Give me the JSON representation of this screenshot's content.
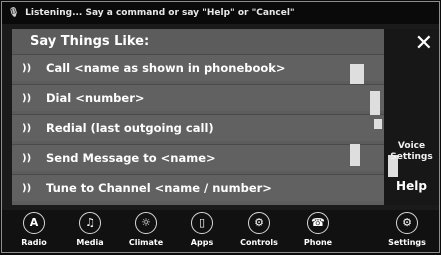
{
  "status": {
    "text": "Listening... Say a command or say \"Help\" or \"Cancel\""
  },
  "panel": {
    "title": "Say Things Like:",
    "items": [
      {
        "label": "Call <name as shown in phonebook>"
      },
      {
        "label": "Dial <number>"
      },
      {
        "label": "Redial (last outgoing call)"
      },
      {
        "label": "Send Message to <name>"
      },
      {
        "label": "Tune to Channel <name / number>"
      }
    ],
    "sound_glyph": "))"
  },
  "side": {
    "close": "✕",
    "voice_settings": "Voice Settings",
    "help": "Help"
  },
  "nav": [
    {
      "label": "Radio",
      "glyph": "A",
      "icon": "radio-icon"
    },
    {
      "label": "Media",
      "glyph": "♫",
      "icon": "media-icon"
    },
    {
      "label": "Climate",
      "glyph": "☼",
      "icon": "climate-icon"
    },
    {
      "label": "Apps",
      "glyph": "▯",
      "icon": "apps-icon"
    },
    {
      "label": "Controls",
      "glyph": "⚙",
      "icon": "controls-icon"
    },
    {
      "label": "Phone",
      "glyph": "☎",
      "icon": "phone-icon"
    },
    {
      "label": "Settings",
      "glyph": "⚙",
      "icon": "settings-icon"
    }
  ]
}
